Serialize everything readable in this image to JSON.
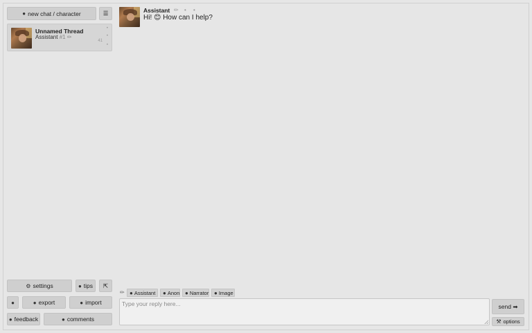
{
  "sidebar": {
    "new_chat_label": "new chat / character",
    "new_chat_icon": "user-plus-icon",
    "menu_icon": "☰",
    "thread": {
      "title": "Unnamed Thread",
      "character": "Assistant",
      "id_label": "#1",
      "edit_icon": "✏",
      "count": "41"
    },
    "bottom": {
      "settings_label": "settings",
      "settings_glyph": "⚙",
      "tips_label": "tips",
      "collapse_glyph": "⇱",
      "export_label": "export",
      "import_label": "import",
      "feedback_label": "feedback",
      "comments_label": "comments"
    }
  },
  "chat": {
    "messages": [
      {
        "author": "Assistant",
        "text": "Hi! 😊 How can I help?",
        "edit_glyph": "✏"
      }
    ]
  },
  "composer": {
    "pencil_glyph": "✏",
    "chips": [
      {
        "label": "Assistant"
      },
      {
        "label": "Anon"
      },
      {
        "label": "Narrator"
      },
      {
        "label": "Image"
      }
    ],
    "placeholder": "Type your reply here...",
    "send_label": "send ➡",
    "options_label": "options",
    "options_glyph": "⚒"
  },
  "colors": {
    "background": "#e6e6e6",
    "button": "#cfcfcf",
    "card": "#d6d6d6",
    "input": "#f0f0f0"
  }
}
